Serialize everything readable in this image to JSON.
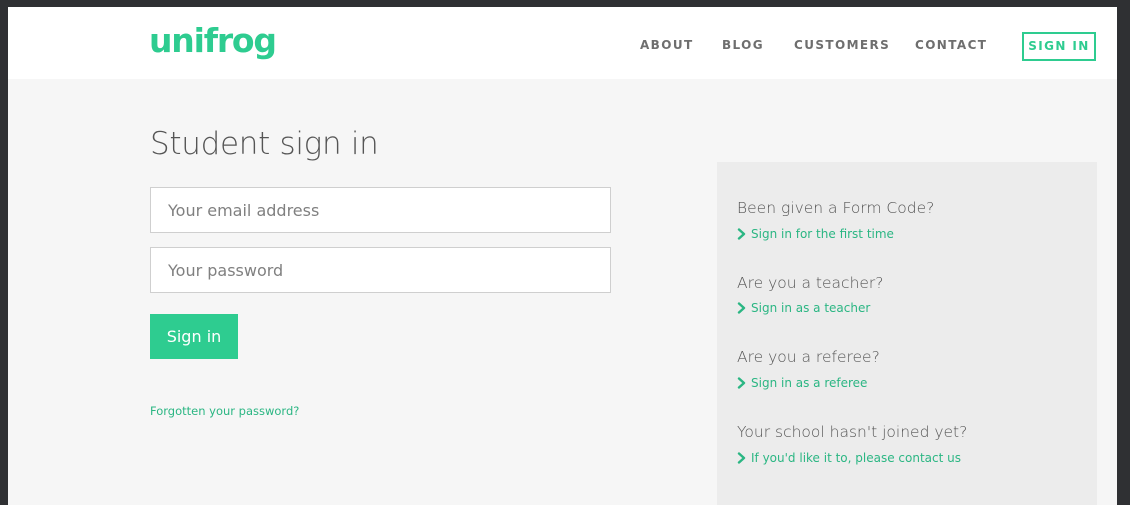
{
  "header": {
    "logo_text": "unifrog",
    "nav": {
      "about": "ABOUT",
      "blog": "BLOG",
      "customers": "CUSTOMERS",
      "contact": "CONTACT"
    },
    "sign_in_label": "SIGN IN"
  },
  "main": {
    "title": "Student sign in",
    "email": {
      "placeholder": "Your email address",
      "value": ""
    },
    "password": {
      "placeholder": "Your password",
      "value": ""
    },
    "submit_label": "Sign in",
    "forgot_label": "Forgotten your password?"
  },
  "panel": {
    "items": [
      {
        "question": "Been given a Form Code?",
        "link": "Sign in for the first time"
      },
      {
        "question": "Are you a teacher?",
        "link": "Sign in as a teacher"
      },
      {
        "question": "Are you a referee?",
        "link": "Sign in as a referee"
      },
      {
        "question": "Your school hasn't joined yet?",
        "link": "If you'd like it to, please contact us"
      }
    ]
  },
  "colors": {
    "accent": "#2ecc90",
    "page_bg": "#f6f6f6",
    "panel_bg": "#ececec",
    "frame_bg": "#2f3033"
  },
  "icons": {
    "link_chevron": "chevron-right-icon"
  }
}
